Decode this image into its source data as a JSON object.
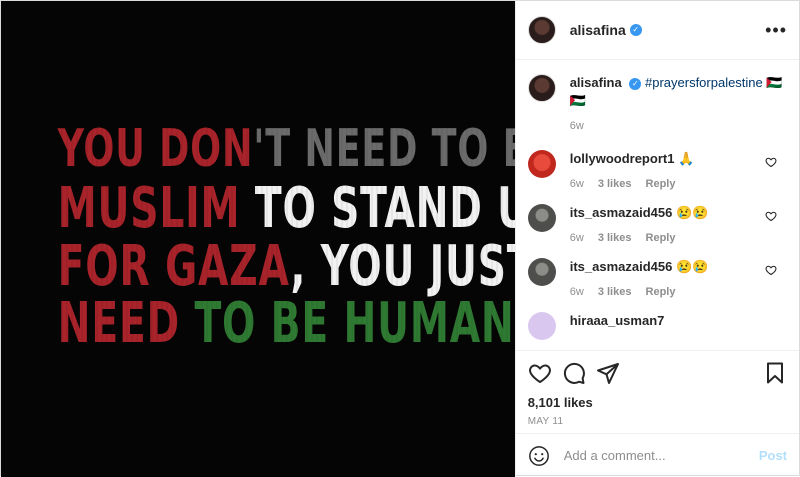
{
  "media": {
    "line1": [
      {
        "text": "YOU DON",
        "tone": "red"
      },
      {
        "text": "'T NEED TO BE",
        "tone": "gray"
      }
    ],
    "line2": [
      {
        "text": "MUSLIM",
        "tone": "red"
      },
      {
        "text": " TO STAND UP",
        "tone": "white"
      }
    ],
    "line3": [
      {
        "text": "FOR GAZA",
        "tone": "red"
      },
      {
        "text": ", YOU JUST",
        "tone": "white"
      }
    ],
    "line4": [
      {
        "text": "NEED ",
        "tone": "red"
      },
      {
        "text": "TO BE HUMAN.",
        "tone": "green"
      }
    ]
  },
  "header": {
    "username": "alisafina",
    "verified_glyph": "✓",
    "more_icon": "more-horizontal-icon",
    "more_label": "•••"
  },
  "caption": {
    "username": "alisafina",
    "hashtag": "#prayersforpalestine",
    "emoji": "🇵🇸 🇵🇸",
    "age": "6w"
  },
  "comments": [
    {
      "username": "lollywoodreport1",
      "text": "🙏",
      "age": "6w",
      "likes": "3 likes",
      "reply": "Reply",
      "avatar": "red"
    },
    {
      "username": "its_asmazaid456",
      "text": "😢😢",
      "age": "6w",
      "likes": "3 likes",
      "reply": "Reply",
      "avatar": "gray"
    },
    {
      "username": "its_asmazaid456",
      "text": "😢😢",
      "age": "6w",
      "likes": "3 likes",
      "reply": "Reply",
      "avatar": "gray"
    },
    {
      "username": "hiraaa_usman7",
      "text": "",
      "age": "",
      "likes": "",
      "reply": "",
      "avatar": "lilac"
    }
  ],
  "actions": {
    "like_icon": "heart-icon",
    "comment_icon": "comment-icon",
    "share_icon": "share-icon",
    "save_icon": "bookmark-icon",
    "likes": "8,101 likes",
    "date": "MAY 11"
  },
  "add_comment": {
    "placeholder": "Add a comment...",
    "post_label": "Post",
    "emoji_icon": "smiley-icon"
  },
  "colors": {
    "verified": "#3897f0",
    "hashtag": "#00376b",
    "post_disabled": "#b2dffc",
    "flag_red": "#a8232a",
    "flag_green": "#2f7a32"
  }
}
